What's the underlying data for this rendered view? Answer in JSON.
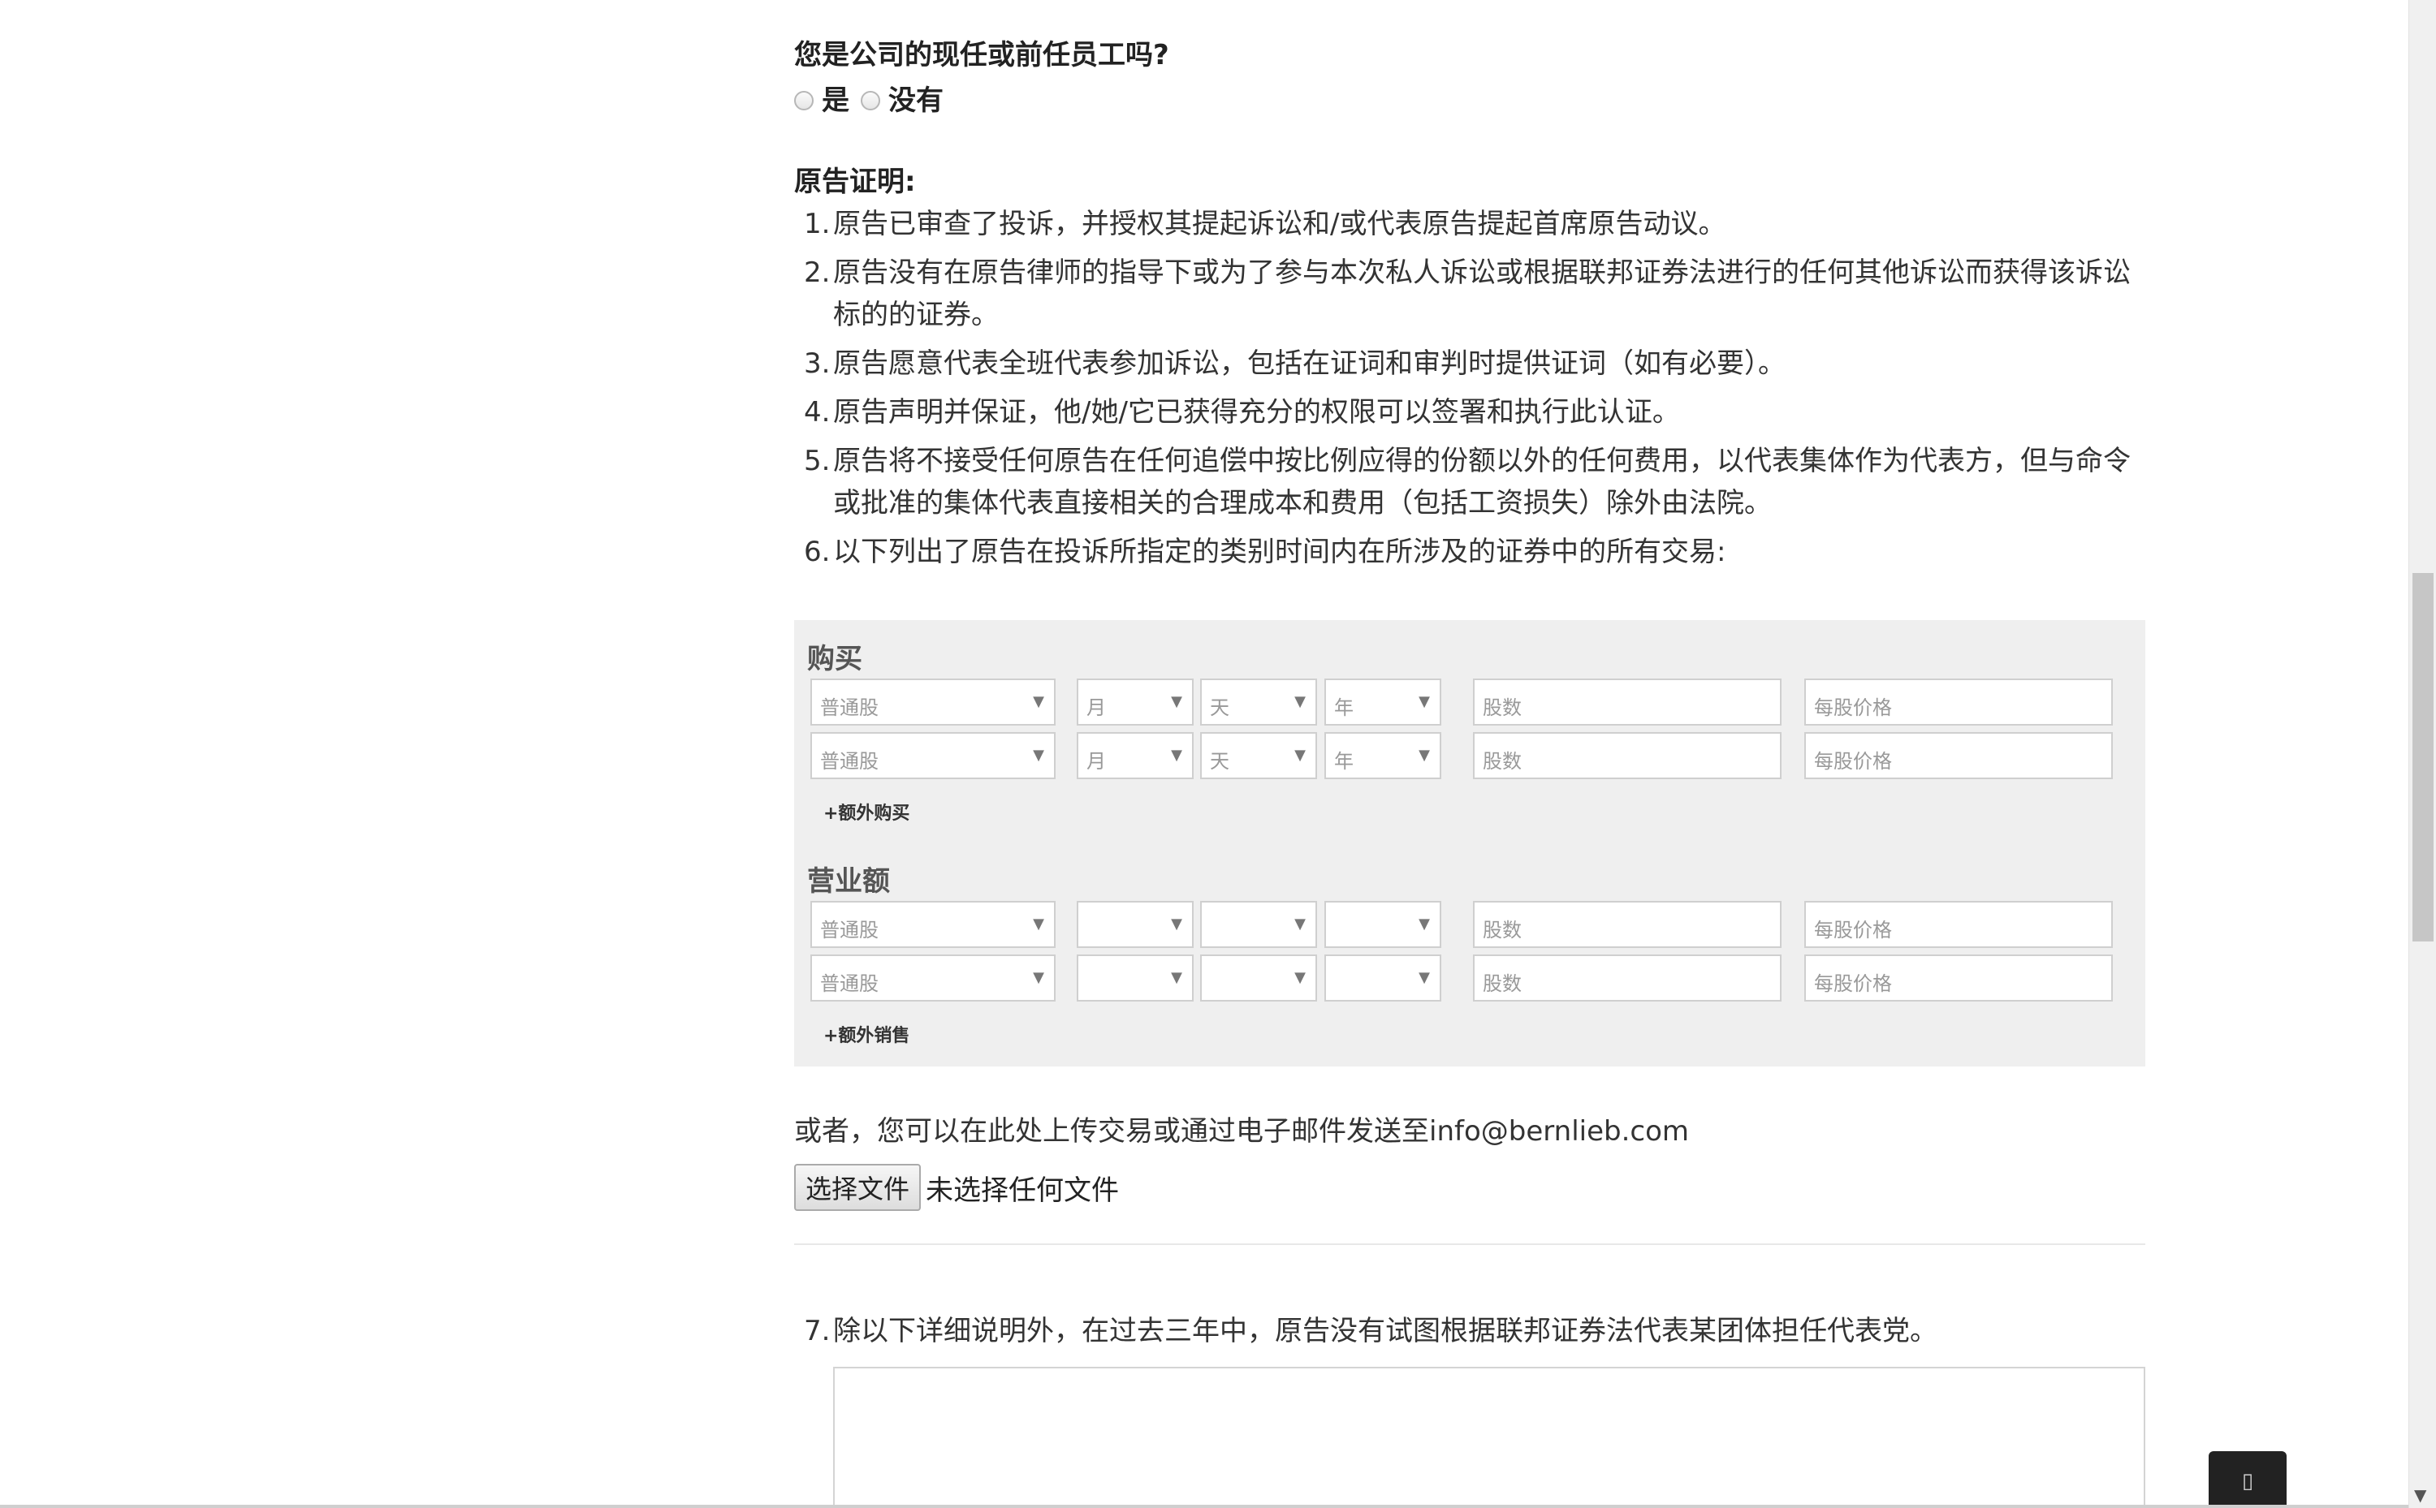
{
  "employee_question": {
    "label": "您是公司的现任或前任员工吗?",
    "options": [
      "是",
      "没有"
    ]
  },
  "certification": {
    "title": "原告证明:",
    "items": [
      {
        "num": "1.",
        "text": "原告已审查了投诉，并授权其提起诉讼和/或代表原告提起首席原告动议。"
      },
      {
        "num": "2.",
        "text": "原告没有在原告律师的指导下或为了参与本次私人诉讼或根据联邦证券法进行的任何其他诉讼而获得该诉讼标的的证券。"
      },
      {
        "num": "3.",
        "text": "原告愿意代表全班代表参加诉讼，包括在证词和审判时提供证词（如有必要）。"
      },
      {
        "num": "4.",
        "text": "原告声明并保证，他/她/它已获得充分的权限可以签署和执行此认证。"
      },
      {
        "num": "5.",
        "text": "原告将不接受任何原告在任何追偿中按比例应得的份额以外的任何费用，以代表集体作为代表方，但与命令或批准的集体代表直接相关的合理成本和费用（包括工资损失）除外由法院。"
      },
      {
        "num": "6.",
        "text": "以下列出了原告在投诉所指定的类别时间内在所涉及的证券中的所有交易:"
      }
    ]
  },
  "purchases": {
    "title": "购买",
    "rows": [
      {
        "type": "普通股",
        "month": "月",
        "day": "天",
        "year": "年",
        "shares_ph": "股数",
        "price_ph": "每股价格"
      },
      {
        "type": "普通股",
        "month": "月",
        "day": "天",
        "year": "年",
        "shares_ph": "股数",
        "price_ph": "每股价格"
      }
    ],
    "add_label": "+额外购买"
  },
  "sales": {
    "title": "营业额",
    "rows": [
      {
        "type": "普通股",
        "month": "",
        "day": "",
        "year": "",
        "shares_ph": "股数",
        "price_ph": "每股价格"
      },
      {
        "type": "普通股",
        "month": "",
        "day": "",
        "year": "",
        "shares_ph": "股数",
        "price_ph": "每股价格"
      }
    ],
    "add_label": "+额外销售"
  },
  "upload": {
    "text": "或者，您可以在此处上传交易或通过电子邮件发送至info@bernlieb.com",
    "button": "选择文件",
    "status": "未选择任何文件"
  },
  "item7": {
    "num": "7.",
    "text": "除以下详细说明外，在过去三年中，原告没有试图根据联邦证券法代表某团体担任代表党。"
  },
  "float_button_icon": "chat-icon"
}
